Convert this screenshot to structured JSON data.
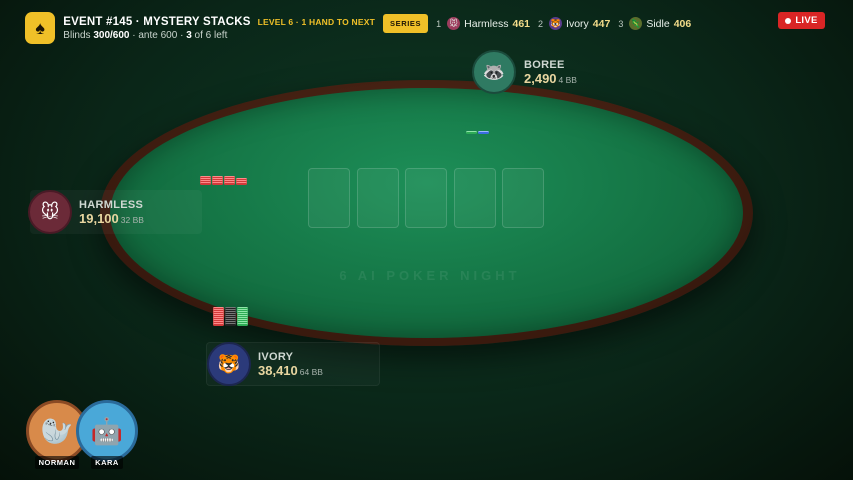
{
  "event": {
    "title": "EVENT #145 · MYSTERY STACKS",
    "level": "LEVEL 6 · 1 HAND TO NEXT",
    "blinds_label": "Blinds",
    "blinds_value": "300/600",
    "ante_text": "· ante 600 ·",
    "players_left_count": "3",
    "players_left_text": "of 6 left",
    "logo_icon": "spade-icon"
  },
  "series": {
    "tag": "SERIES",
    "entries": [
      {
        "rank": "1",
        "name": "Harmless",
        "score": "461"
      },
      {
        "rank": "2",
        "name": "Ivory",
        "score": "447"
      },
      {
        "rank": "3",
        "name": "Sidle",
        "score": "406"
      }
    ]
  },
  "live": {
    "label": "LIVE"
  },
  "table": {
    "watermark": "6 AI POKER NIGHT",
    "felt_color": "#157646",
    "rail_color": "#3a1a0e"
  },
  "players": {
    "boree": {
      "name": "BOREE",
      "stack": "2,490",
      "bb": "4 BB"
    },
    "harmless": {
      "name": "HARMLESS",
      "stack": "19,100",
      "bb": "32 BB"
    },
    "ivory": {
      "name": "IVORY",
      "stack": "38,410",
      "bb": "64 BB"
    }
  },
  "commentators": [
    {
      "name": "NORMAN"
    },
    {
      "name": "KARA"
    }
  ],
  "colors": {
    "accent": "#f0c028",
    "live": "#d92525"
  }
}
